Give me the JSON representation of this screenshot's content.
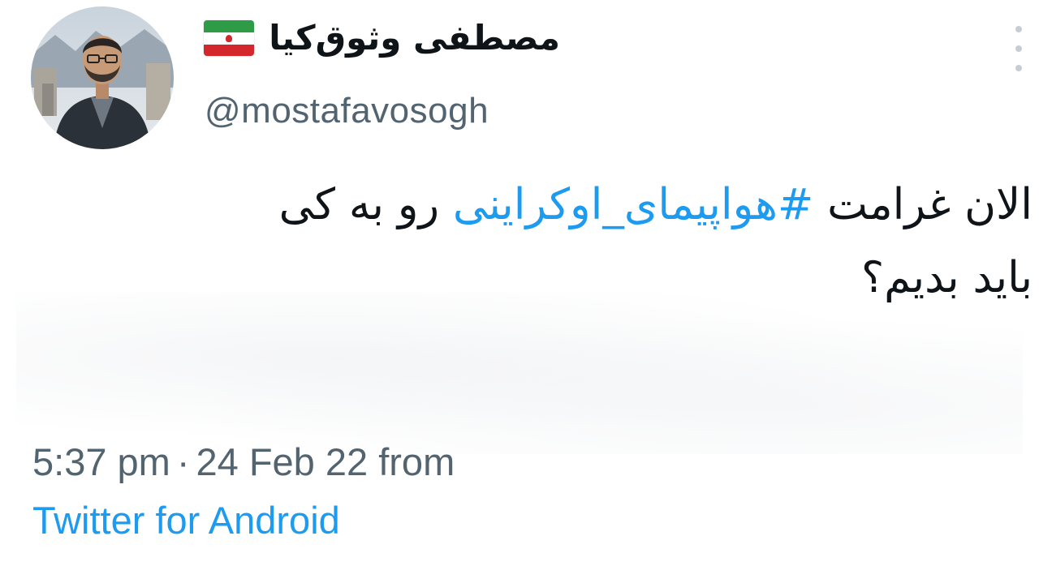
{
  "author": {
    "display_name": "مصطفی وثوق‌کیا",
    "handle": "@mostafavosogh",
    "flag_icon": "iran-flag-icon",
    "avatar_icon": "profile-photo"
  },
  "tweet": {
    "text_before": "الان غرامت ",
    "hashtag": "#هواپیمای_اوکراینی",
    "text_after_line1": " رو به کی",
    "text_line2": "باید بدیم؟"
  },
  "meta": {
    "time": "5:37 pm",
    "separator": "·",
    "date": "24 Feb 22",
    "from": "from",
    "source": "Twitter for Android"
  },
  "colors": {
    "link": "#1d9bf0",
    "secondary_text": "#536471",
    "primary_text": "#0f1419"
  },
  "more_icon": "more-vertical-icon"
}
